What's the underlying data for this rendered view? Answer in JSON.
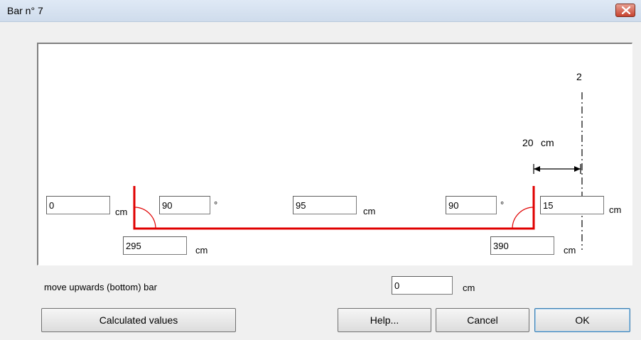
{
  "window": {
    "title": "Bar n° 7",
    "close_icon": "close-icon"
  },
  "drawing": {
    "axis_label": "2",
    "offset_value": "20",
    "offset_unit": "cm",
    "bar_color": "#e00000",
    "fields": {
      "left_hook_length": "0",
      "left_hook_unit": "cm",
      "left_angle": "90",
      "left_angle_unit": "°",
      "middle_length": "95",
      "middle_unit": "cm",
      "right_angle": "90",
      "right_angle_unit": "°",
      "right_hook_length": "15",
      "right_hook_unit": "cm",
      "left_position": "295",
      "left_position_unit": "cm",
      "right_position": "390",
      "right_position_unit": "cm"
    }
  },
  "move": {
    "label": "move upwards (bottom) bar",
    "value": "0",
    "unit": "cm"
  },
  "buttons": {
    "calculated": "Calculated values",
    "help": "Help...",
    "cancel": "Cancel",
    "ok": "OK"
  }
}
